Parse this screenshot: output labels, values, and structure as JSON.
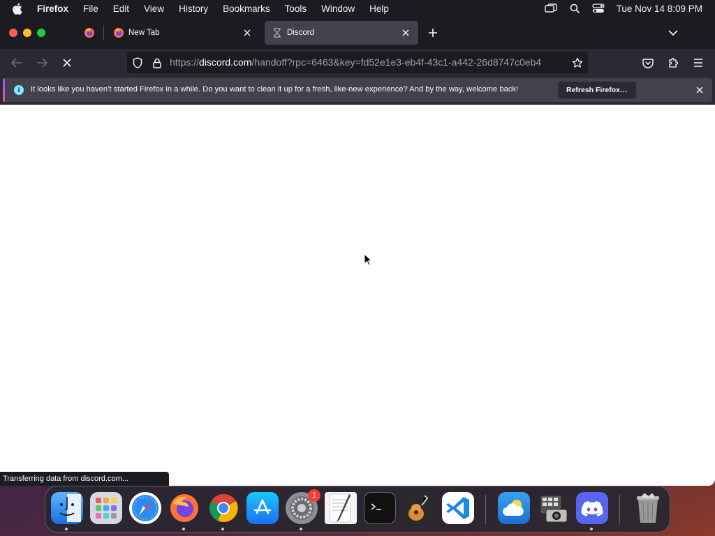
{
  "menubar": {
    "app_name": "Firefox",
    "items": [
      "File",
      "Edit",
      "View",
      "History",
      "Bookmarks",
      "Tools",
      "Window",
      "Help"
    ],
    "clock": "Tue Nov 14  8:09 PM"
  },
  "tabs": [
    {
      "title": "New Tab"
    },
    {
      "title": "Discord"
    }
  ],
  "urlbar": {
    "scheme": "https://",
    "host": "discord.com",
    "path": "/handoff?rpc=6463&key=fd52e1e3-eb4f-43c1-a442-26d8747c0eb4"
  },
  "notification": {
    "message": "It looks like you haven’t started Firefox in a while. Do you want to clean it up for a fresh, like-new experience? And by the way, welcome back!",
    "button_label": "Refresh Firefox…"
  },
  "status_text": "Transferring data from discord.com...",
  "dock": {
    "apps": [
      "Finder",
      "Launchpad",
      "Safari",
      "Firefox",
      "Chrome",
      "App Store",
      "System Settings",
      "TextEdit",
      "Terminal",
      "GarageBand",
      "Visual Studio Code",
      "Weather",
      "Image Capture",
      "Discord",
      "Trash"
    ],
    "settings_badge": "1"
  },
  "colors": {
    "toolbar": "#2b2a33",
    "tabstrip": "#1c1b22",
    "active_tab": "#42414d",
    "info_icon": "#80ebff"
  }
}
